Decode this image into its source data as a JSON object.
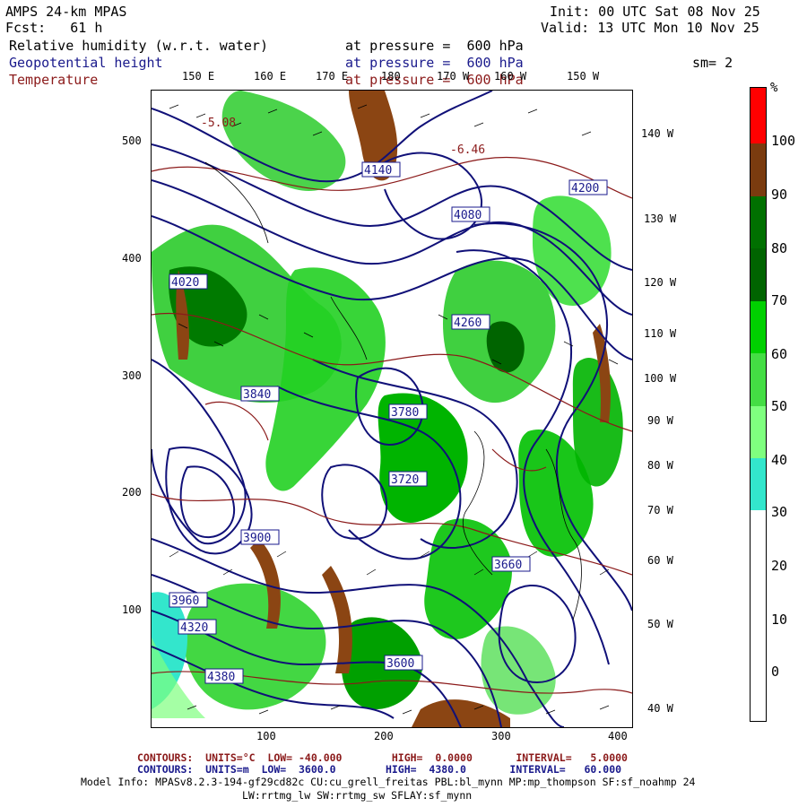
{
  "header": {
    "title": "AMPS 24-km MPAS",
    "forecast": "Fcst:   61 h",
    "init": "Init: 00 UTC Sat 08 Nov 25",
    "valid": "Valid: 13 UTC Mon 10 Nov 25",
    "smoothing": "sm= 2"
  },
  "fields": [
    {
      "name": "Relative humidity (w.r.t. water)",
      "level": "at pressure =  600 hPa",
      "color": "#000000"
    },
    {
      "name": "Geopotential height",
      "level": "at pressure =  600 hPa",
      "color": "#1a1a8c"
    },
    {
      "name": "Temperature",
      "level": "at pressure =  600 hPa",
      "color": "#8b1a1a"
    }
  ],
  "map": {
    "top_longitudes": [
      "150 E",
      "160 E",
      "170 E",
      "180",
      "170 W",
      "160 W",
      "150 W"
    ],
    "right_longitudes": [
      "140 W",
      "130 W",
      "120 W",
      "110 W",
      "100 W",
      "90 W",
      "80 W",
      "70 W",
      "60 W",
      "50 W",
      "40 W"
    ],
    "y_ticks": [
      "500",
      "400",
      "300",
      "200",
      "100"
    ],
    "x_ticks": [
      "100",
      "200",
      "300",
      "400"
    ],
    "height_labels": [
      "4140",
      "4080",
      "4200",
      "4020",
      "3840",
      "3960",
      "3900",
      "3780",
      "3720",
      "4260",
      "4320",
      "4380",
      "3600",
      "3660"
    ],
    "temp_labels": [
      "-5.08",
      "-6.46"
    ]
  },
  "colorbar": {
    "unit": "%",
    "labels": [
      "100",
      "90",
      "80",
      "70",
      "60",
      "50",
      "40",
      "30",
      "20",
      "10",
      "0"
    ],
    "colors": [
      "#ff0000",
      "#7a3b0f",
      "#8b4513",
      "#006400",
      "#00a000",
      "#00e000",
      "#5fe05f",
      "#7fff7f",
      "#00c0a0",
      "#33e6cc",
      "#ffffff",
      "#ffffff",
      "#ffffff"
    ]
  },
  "footer": {
    "temp_contours": "CONTOURS:  UNITS=°C  LOW= -40.000        HIGH=  0.0000       INTERVAL=   5.0000",
    "height_contours": "CONTOURS:  UNITS=m  LOW=  3600.0        HIGH=  4380.0       INTERVAL=   60.000",
    "model_info": "Model Info: MPASv8.2.3-194-gf29cd82c CU:cu_grell_freitas PBL:bl_mynn MP:mp_thompson SF:sf_noahmp 24",
    "model_info2": "LW:rrtmg_lw SW:rrtmg_sw SFLAY:sf_mynn"
  }
}
